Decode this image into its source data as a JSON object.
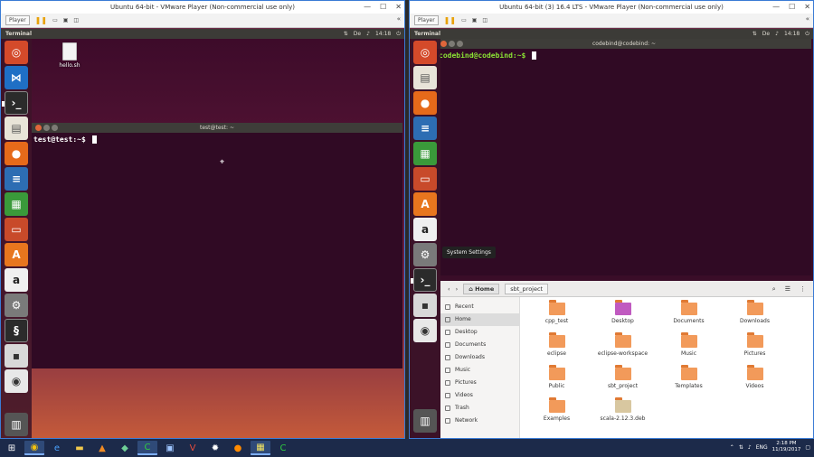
{
  "left_vm": {
    "title": "Ubuntu 64-bit - VMware Player (Non-commercial use only)",
    "player_label": "Player",
    "panel_app": "Terminal",
    "panel_kbd": "De",
    "panel_time": "14:18",
    "desktop_file": "hello.sh",
    "terminal_title": "test@test: ~",
    "prompt": "test@test:~$"
  },
  "right_vm": {
    "title": "Ubuntu 64-bit (3) 16.4 LTS - VMware Player (Non-commercial use only)",
    "player_label": "Player",
    "panel_app": "Terminal",
    "panel_kbd": "De",
    "panel_time": "14:18",
    "terminal_title": "codebind@codebind: ~",
    "prompt": "codebind@codebind:~$",
    "tooltip": "System Settings",
    "files": {
      "home_label": "Home",
      "crumb": "sbt_project",
      "sidebar": [
        "Recent",
        "Home",
        "Desktop",
        "Documents",
        "Downloads",
        "Music",
        "Pictures",
        "Videos",
        "Trash",
        "Network"
      ],
      "items": [
        {
          "name": "cpp_test",
          "kind": "folder"
        },
        {
          "name": "Desktop",
          "kind": "purple"
        },
        {
          "name": "Documents",
          "kind": "folder"
        },
        {
          "name": "Downloads",
          "kind": "folder"
        },
        {
          "name": "eclipse",
          "kind": "folder"
        },
        {
          "name": "eclipse-workspace",
          "kind": "folder"
        },
        {
          "name": "Music",
          "kind": "folder"
        },
        {
          "name": "Pictures",
          "kind": "folder"
        },
        {
          "name": "Public",
          "kind": "folder"
        },
        {
          "name": "sbt_project",
          "kind": "folder"
        },
        {
          "name": "Templates",
          "kind": "folder"
        },
        {
          "name": "Videos",
          "kind": "folder"
        },
        {
          "name": "Examples",
          "kind": "folder"
        },
        {
          "name": "scala-2.12.3.deb",
          "kind": "pkg"
        }
      ]
    }
  },
  "taskbar": {
    "time": "2:18 PM",
    "date": "11/19/2017",
    "lang": "ENG"
  }
}
